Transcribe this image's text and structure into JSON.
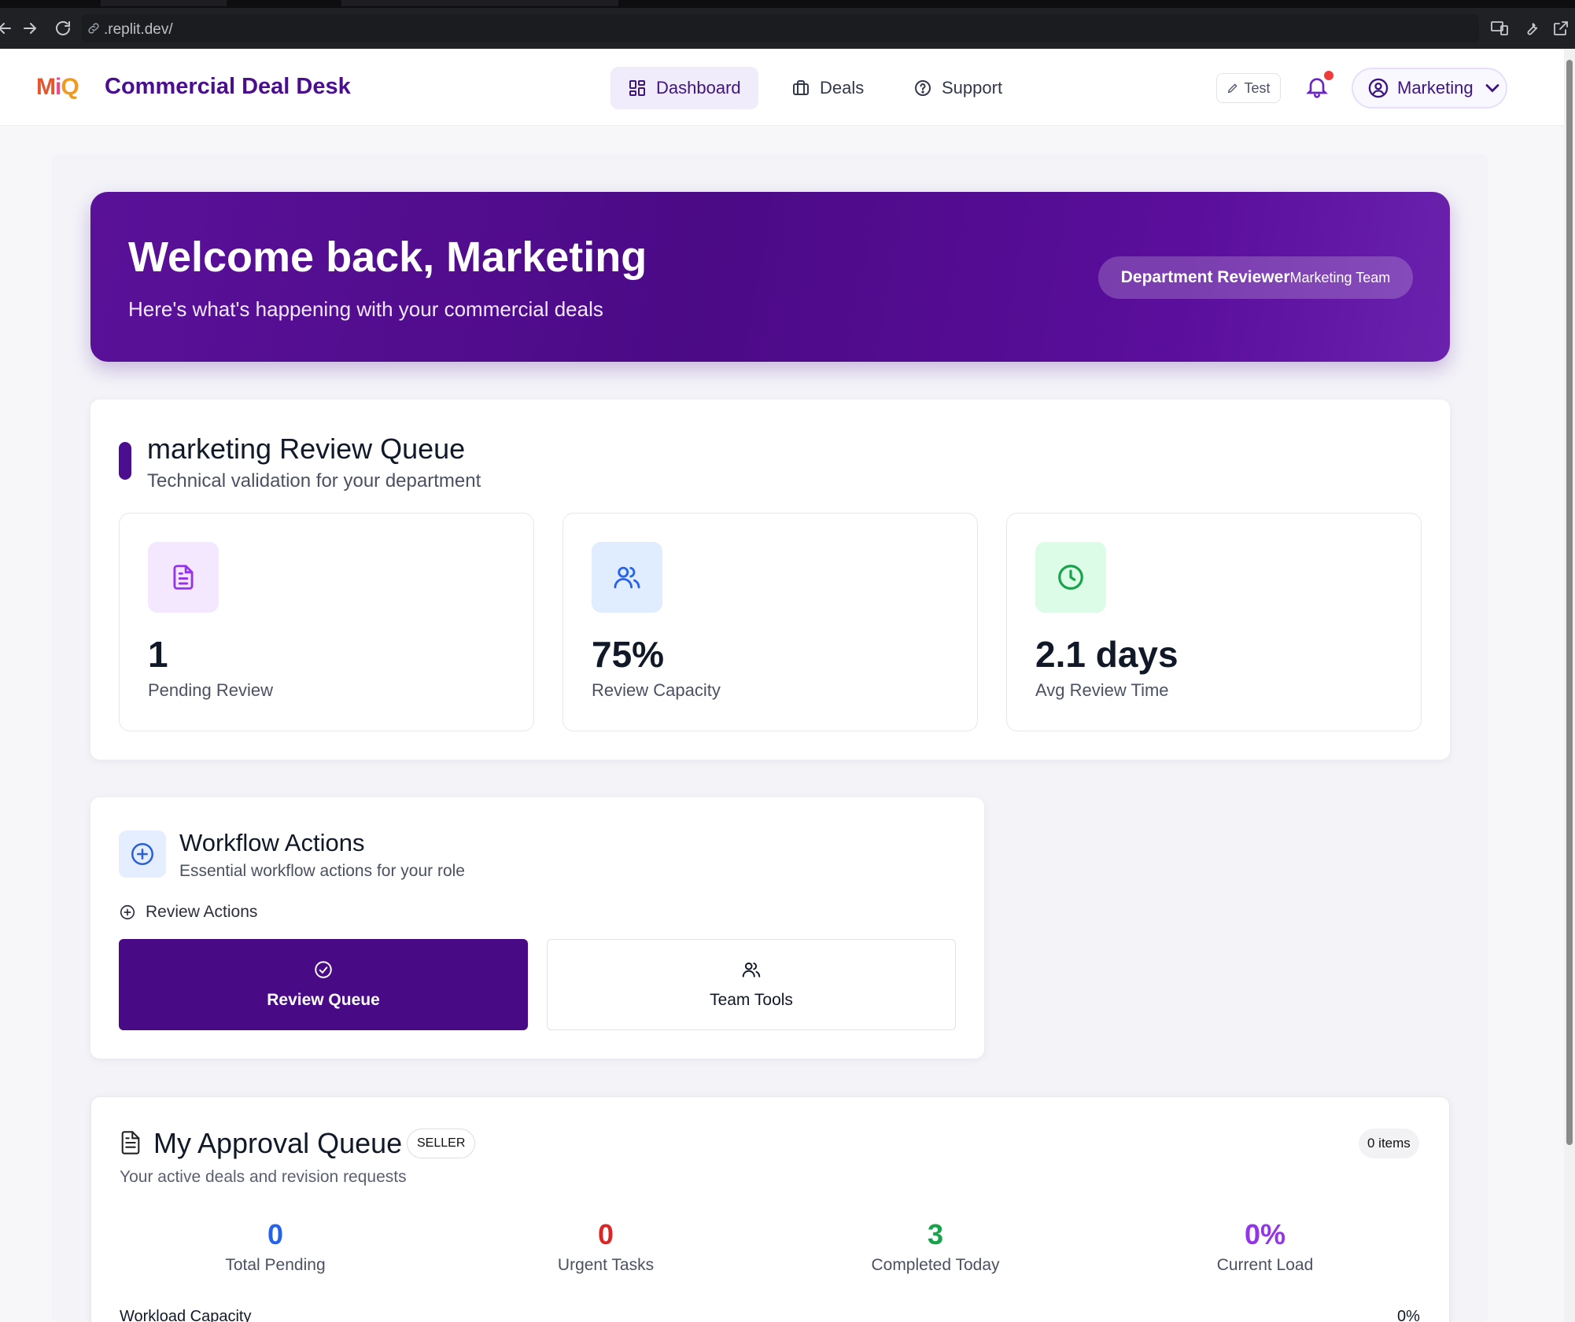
{
  "browser": {
    "url": ".replit.dev/"
  },
  "header": {
    "logo": {
      "m": "M",
      "i": "i",
      "q": "Q"
    },
    "app_title": "Commercial Deal Desk",
    "nav": [
      {
        "label": "Dashboard",
        "icon": "dashboard-grid-icon",
        "active": true
      },
      {
        "label": "Deals",
        "icon": "briefcase-icon",
        "active": false
      },
      {
        "label": "Support",
        "icon": "help-circle-icon",
        "active": false
      }
    ],
    "test_label": "Test",
    "user_label": "Marketing"
  },
  "hero": {
    "title": "Welcome back, Marketing",
    "subtitle": "Here's what's happening with your commercial deals",
    "role": "Department Reviewer",
    "team": "Marketing Team"
  },
  "review_queue": {
    "title": "marketing Review Queue",
    "subtitle": "Technical validation for your department",
    "stats": [
      {
        "value": "1",
        "label": "Pending Review",
        "icon": "document-icon",
        "color": "#9333ea",
        "bg": "#f3e8ff"
      },
      {
        "value": "75%",
        "label": "Review Capacity",
        "icon": "users-icon",
        "color": "#2563eb",
        "bg": "#e0ecff"
      },
      {
        "value": "2.1 days",
        "label": "Avg Review Time",
        "icon": "clock-icon",
        "color": "#16a34a",
        "bg": "#dcfce7"
      }
    ]
  },
  "workflow": {
    "title": "Workflow Actions",
    "subtitle": "Essential workflow actions for your role",
    "section_label": "Review Actions",
    "primary_label": "Review Queue",
    "secondary_label": "Team Tools"
  },
  "approval_queue": {
    "title": "My Approval Queue",
    "badge": "SELLER",
    "items_badge": "0 items",
    "subtitle": "Your active deals and revision requests",
    "metrics": [
      {
        "value": "0",
        "label": "Total Pending",
        "color": "#2563eb"
      },
      {
        "value": "0",
        "label": "Urgent Tasks",
        "color": "#dc2626"
      },
      {
        "value": "3",
        "label": "Completed Today",
        "color": "#16a34a"
      },
      {
        "value": "0%",
        "label": "Current Load",
        "color": "#9333ea"
      }
    ],
    "workload_label": "Workload Capacity",
    "workload_value": "0%"
  }
}
